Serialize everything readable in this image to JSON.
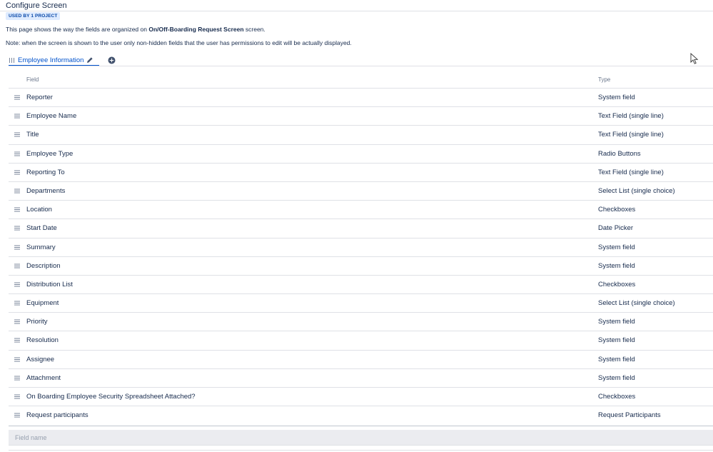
{
  "header": {
    "title": "Configure Screen",
    "badge": "USED BY 1 PROJECT"
  },
  "description": {
    "line1_prefix": "This page shows the way the fields are organized on ",
    "line1_screen_name": "On/Off-Boarding Request Screen",
    "line1_suffix": " screen.",
    "note": "Note: when the screen is shown to the user only non-hidden fields that the user has permissions to edit will be actually displayed."
  },
  "tabs": [
    {
      "label": "Employee Information",
      "icons": [
        "grip-icon",
        "pencil-icon"
      ]
    }
  ],
  "add_tab_icon": "plus-circle-icon",
  "table": {
    "columns": [
      "Field",
      "Type"
    ],
    "rows": [
      {
        "field": "Reporter",
        "type": "System field"
      },
      {
        "field": "Employee Name",
        "type": "Text Field (single line)"
      },
      {
        "field": "Title",
        "type": "Text Field (single line)"
      },
      {
        "field": "Employee Type",
        "type": "Radio Buttons"
      },
      {
        "field": "Reporting To",
        "type": "Text Field (single line)"
      },
      {
        "field": "Departments",
        "type": "Select List (single choice)"
      },
      {
        "field": "Location",
        "type": "Checkboxes"
      },
      {
        "field": "Start Date",
        "type": "Date Picker"
      },
      {
        "field": "Summary",
        "type": "System field"
      },
      {
        "field": "Description",
        "type": "System field"
      },
      {
        "field": "Distribution List",
        "type": "Checkboxes"
      },
      {
        "field": "Equipment",
        "type": "Select List (single choice)"
      },
      {
        "field": "Priority",
        "type": "System field"
      },
      {
        "field": "Resolution",
        "type": "System field"
      },
      {
        "field": "Assignee",
        "type": "System field"
      },
      {
        "field": "Attachment",
        "type": "System field"
      },
      {
        "field": "On Boarding Employee Security Spreadsheet Attached?",
        "type": "Checkboxes"
      },
      {
        "field": "Request participants",
        "type": "Request Participants"
      }
    ]
  },
  "add_field": {
    "value": "",
    "placeholder": "Field name"
  },
  "colors": {
    "accent": "#0052cc",
    "badge_bg": "#deebff",
    "badge_text": "#0747a6",
    "text": "#172b4d",
    "muted": "#6b778c",
    "divider": "#dfe1e6",
    "input_bg": "#ebecf0"
  }
}
